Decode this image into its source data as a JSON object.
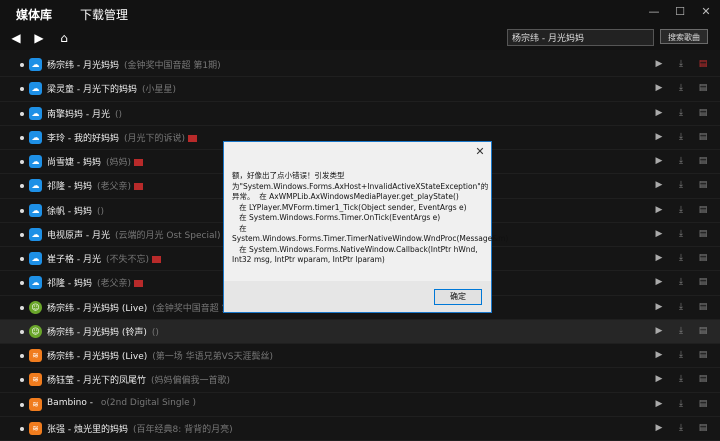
{
  "header": {
    "app_title": "媒体库",
    "manage_title": "下载管理",
    "window_controls": [
      "minimize-icon",
      "maximize-icon",
      "close-icon"
    ]
  },
  "toolbar": {
    "back_icon": "arrow-left-icon",
    "forward_icon": "arrow-right-icon",
    "home_icon": "home-icon",
    "search_value": "杨宗纬 - 月光妈妈",
    "search_button": "搜索歌曲"
  },
  "songs": [
    {
      "artist": "杨宗纬",
      "title": "月光妈妈",
      "album": "(金钟奖中国音超 第1期)",
      "tag": false,
      "icon": "blue"
    },
    {
      "artist": "梁灵童",
      "title": "月光下的妈妈",
      "album": "(小星星)",
      "tag": false,
      "icon": "blue"
    },
    {
      "artist": "南擎妈妈",
      "title": "月光",
      "album": "()",
      "tag": false,
      "icon": "blue"
    },
    {
      "artist": "李玲",
      "title": "我的好妈妈",
      "album": "(月光下的诉说)",
      "tag": true,
      "icon": "blue"
    },
    {
      "artist": "尚雪婕",
      "title": "妈妈",
      "album": "(妈妈)",
      "tag": true,
      "icon": "blue"
    },
    {
      "artist": "祁隆",
      "title": "妈妈",
      "album": "(老父亲)",
      "tag": true,
      "icon": "blue"
    },
    {
      "artist": "徐帆",
      "title": "妈妈",
      "album": "()",
      "tag": false,
      "icon": "blue"
    },
    {
      "artist": "电视原声",
      "title": "月光",
      "album": "(云端的月光 Ost Special)",
      "tag": false,
      "icon": "blue"
    },
    {
      "artist": "崔子格",
      "title": "月光",
      "album": "(不失不忘)",
      "tag": true,
      "icon": "blue"
    },
    {
      "artist": "祁隆",
      "title": "妈妈",
      "album": "(老父亲)",
      "tag": true,
      "icon": "blue"
    },
    {
      "artist": "杨宗纬",
      "title": "月光妈妈 (Live)",
      "album": "(金钟奖中国音超 第1期)",
      "tag": false,
      "icon": "green"
    },
    {
      "artist": "杨宗纬",
      "title": "月光妈妈 (铃声)",
      "album": "()",
      "tag": false,
      "icon": "green"
    },
    {
      "artist": "杨宗纬",
      "title": "月光妈妈 (Live)",
      "album": "(第一场 华语兄弟VS天涯鬓丝)",
      "tag": false,
      "icon": "orange"
    },
    {
      "artist": "杨钰莹",
      "title": "月光下的凤尾竹",
      "album": "(妈妈偏偏我一首歌)",
      "tag": false,
      "icon": "orange"
    },
    {
      "artist": "Bambino",
      "title": "",
      "album": "o(2nd Digital Single )",
      "tag": false,
      "icon": "orange"
    },
    {
      "artist": "张强",
      "title": "烛光里的妈妈",
      "album": "(百年经典8: 背背的月亮)",
      "tag": false,
      "icon": "orange"
    }
  ],
  "row_icons": {
    "play": "play-icon",
    "download": "download-icon",
    "delete": "delete-icon"
  },
  "colors": {
    "background": "#151515",
    "blue_badge": "#1e90e6",
    "orange_badge": "#f07c1e",
    "green_badge": "#6aa62a",
    "dialog_border": "#1a77c9"
  },
  "dialog": {
    "message": "额，好像出了点小错误！引发类型为\"System.Windows.Forms.AxHost+InvalidActiveXStateException\"的异常。  在 AxWMPLib.AxWindowsMediaPlayer.get_playState()\n   在 LYPlayer.MVForm.timer1_Tick(Object sender, EventArgs e)\n   在 System.Windows.Forms.Timer.OnTick(EventArgs e)\n   在 System.Windows.Forms.Timer.TimerNativeWindow.WndProc(Message&m)\n   在 System.Windows.Forms.NativeWindow.Callback(IntPtr hWnd, Int32 msg, IntPtr wparam, IntPtr lparam)",
    "ok_button": "确定",
    "close_icon": "close-icon"
  }
}
